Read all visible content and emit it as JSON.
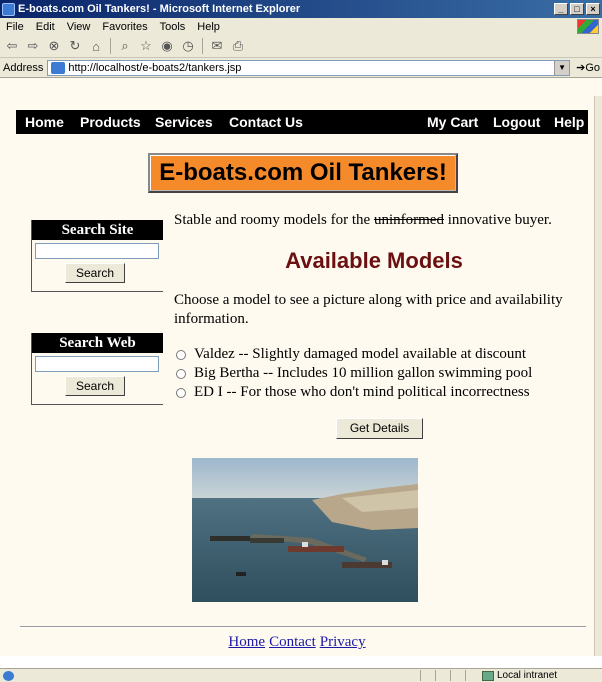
{
  "window": {
    "title": "E-boats.com Oil Tankers! - Microsoft Internet Explorer",
    "minimize": "_",
    "maximize": "□",
    "close": "×"
  },
  "menu": [
    "File",
    "Edit",
    "View",
    "Favorites",
    "Tools",
    "Help"
  ],
  "address": {
    "label": "Address",
    "url": "http://localhost/e-boats2/tankers.jsp",
    "go_label": "Go"
  },
  "nav": {
    "home": "Home",
    "products": "Products",
    "services": "Services",
    "contact": "Contact Us",
    "cart": "My Cart",
    "logout": "Logout",
    "help": "Help"
  },
  "banner": "E-boats.com Oil Tankers!",
  "search_site": {
    "title": "Search Site",
    "button": "Search"
  },
  "search_web": {
    "title": "Search Web",
    "button": "Search"
  },
  "intro": {
    "before": "Stable and roomy models for the ",
    "struck": "uninformed",
    "after": " innovative buyer."
  },
  "heading": "Available Models",
  "choose_text": "Choose a model to see a picture along with price and availability information.",
  "models": [
    "Valdez -- Slightly damaged model available at discount",
    "Big Bertha -- Includes 10 million gallon swimming pool",
    "ED I -- For those who don't mind political incorrectness"
  ],
  "details_button": "Get Details",
  "footer": {
    "home": "Home",
    "contact": "Contact",
    "privacy": "Privacy"
  },
  "status": {
    "zone": "Local intranet"
  },
  "colors": {
    "page_bg": "#fffaf0",
    "banner_bg": "#f48a2a",
    "heading": "#6b1010",
    "link": "#1a1aa6"
  }
}
